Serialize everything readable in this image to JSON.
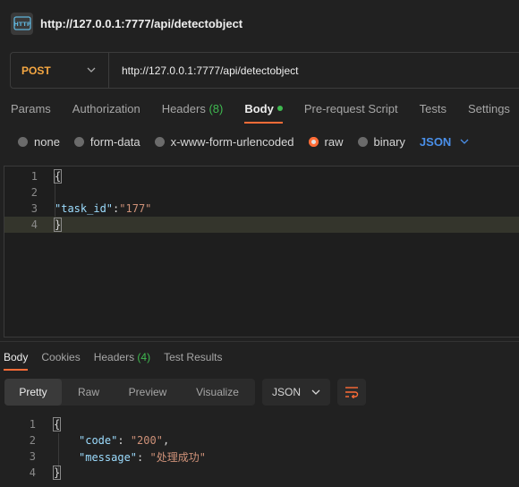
{
  "window": {
    "title": "http://127.0.0.1:7777/api/detectobject",
    "icon": "http-icon"
  },
  "request": {
    "method": "POST",
    "url": "http://127.0.0.1:7777/api/detectobject"
  },
  "request_tabs": {
    "params": "Params",
    "authorization": "Authorization",
    "headers_label": "Headers",
    "headers_count": "(8)",
    "body": "Body",
    "pre_request": "Pre-request Script",
    "tests": "Tests",
    "settings": "Settings"
  },
  "body_options": {
    "none": "none",
    "form_data": "form-data",
    "urlencoded": "x-www-form-urlencoded",
    "raw": "raw",
    "binary": "binary",
    "format": "JSON"
  },
  "request_body": {
    "lines": [
      {
        "n": "1",
        "text": "{"
      },
      {
        "n": "2",
        "text": ""
      },
      {
        "n": "3",
        "key": "\"task_id\"",
        "sep": ":",
        "value": "\"177\""
      },
      {
        "n": "4",
        "text": "}"
      }
    ]
  },
  "response_tabs": {
    "body": "Body",
    "cookies": "Cookies",
    "headers_label": "Headers",
    "headers_count": "(4)",
    "test_results": "Test Results"
  },
  "response_view": {
    "pretty": "Pretty",
    "raw": "Raw",
    "preview": "Preview",
    "visualize": "Visualize",
    "format": "JSON"
  },
  "response_body": {
    "lines": [
      {
        "n": "1",
        "text": "{"
      },
      {
        "n": "2",
        "key": "\"code\"",
        "sep": ": ",
        "value": "\"200\"",
        "tail": ","
      },
      {
        "n": "3",
        "key": "\"message\"",
        "sep": ": ",
        "value": "\"处理成功\"",
        "tail": ""
      },
      {
        "n": "4",
        "text": "}"
      }
    ]
  },
  "colors": {
    "accent": "#ff6c37",
    "method": "#f5a742",
    "format": "#4a8fe8",
    "count": "#3fb950"
  }
}
